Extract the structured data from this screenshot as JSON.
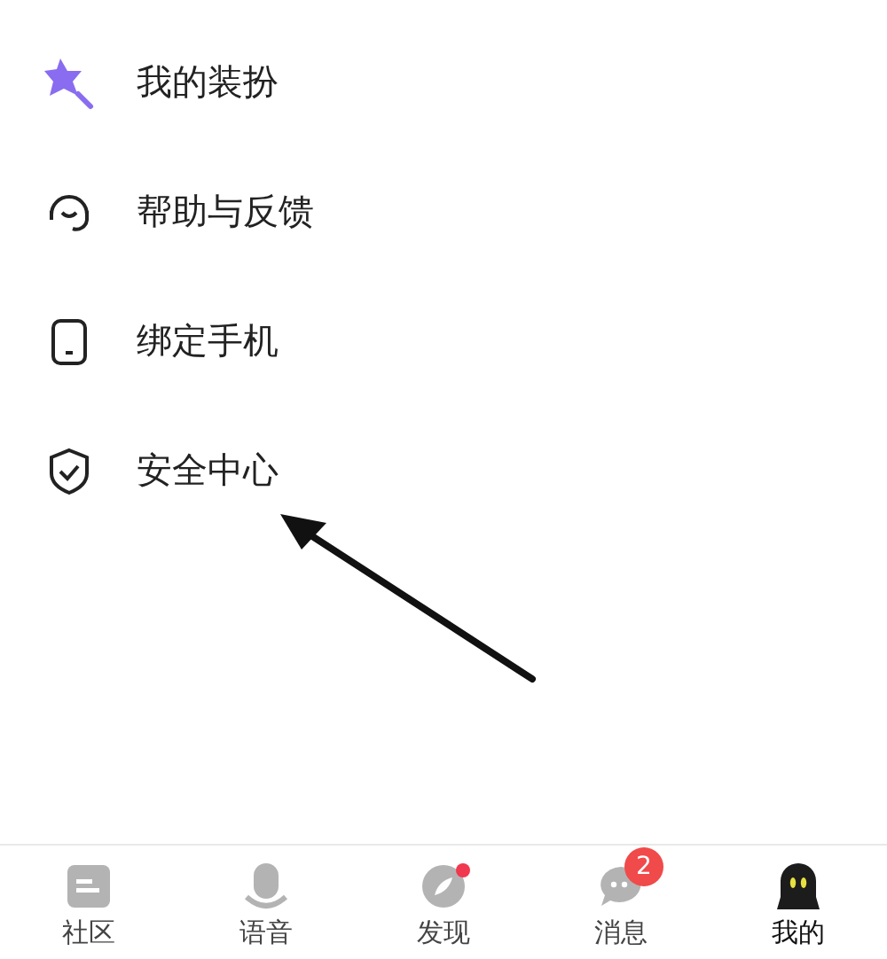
{
  "menu": [
    {
      "label": "我的装扮"
    },
    {
      "label": "帮助与反馈"
    },
    {
      "label": "绑定手机"
    },
    {
      "label": "安全中心"
    }
  ],
  "tabs": [
    {
      "label": "社区",
      "selected": false
    },
    {
      "label": "语音",
      "selected": false
    },
    {
      "label": "发现",
      "selected": false,
      "dot": true
    },
    {
      "label": "消息",
      "selected": false,
      "badge": "2"
    },
    {
      "label": "我的",
      "selected": true
    }
  ]
}
